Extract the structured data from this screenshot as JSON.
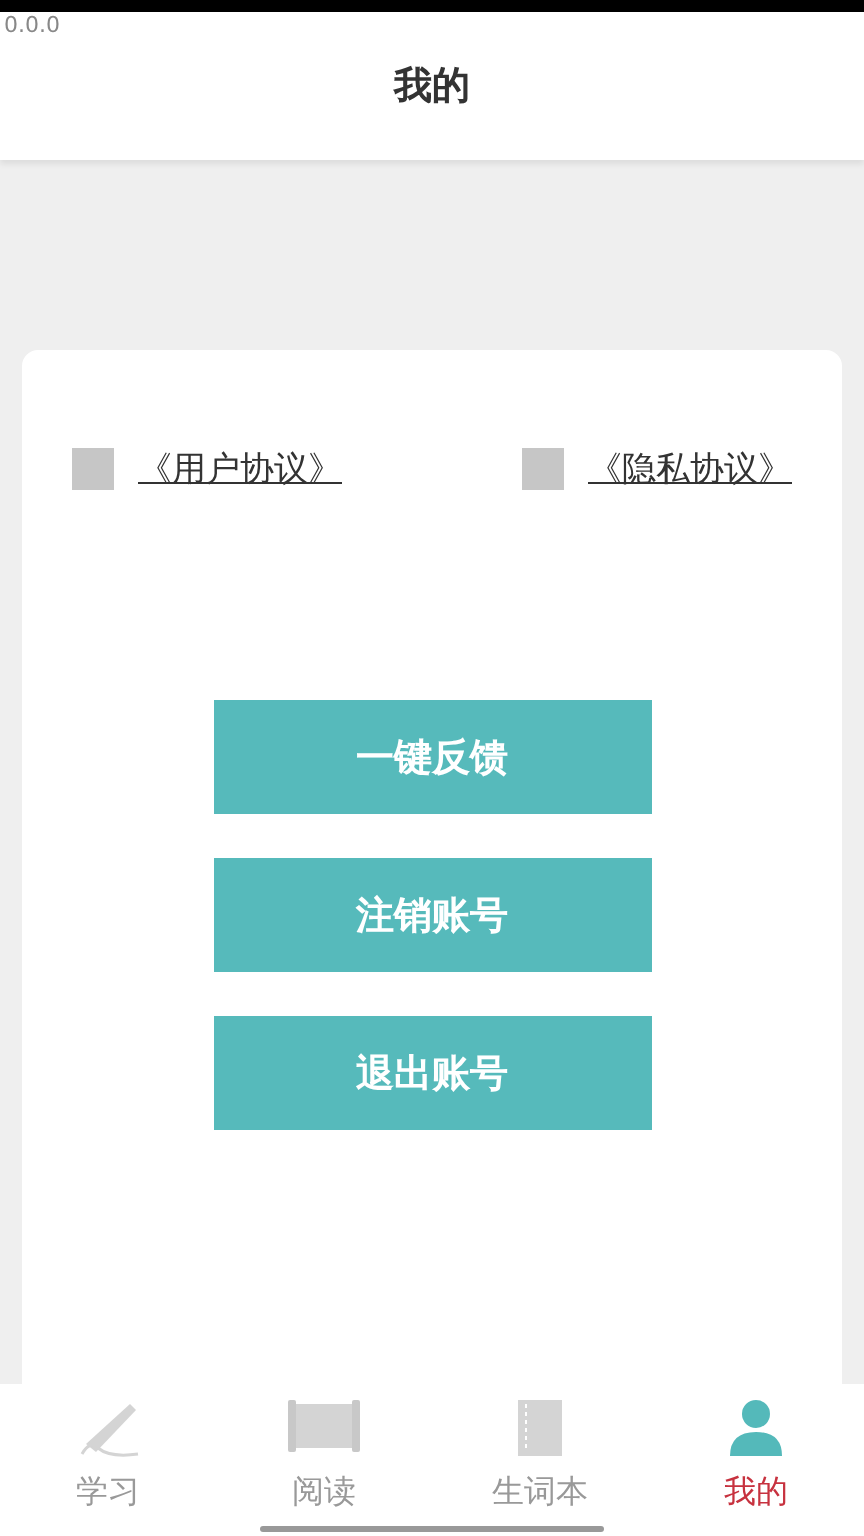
{
  "version": "0.0.0",
  "header": {
    "title": "我的"
  },
  "agreements": [
    {
      "label": "《用户协议》",
      "checked": false
    },
    {
      "label": "《隐私协议》",
      "checked": false
    }
  ],
  "buttons": [
    "一键反馈",
    "注销账号",
    "退出账号"
  ],
  "tabs": [
    {
      "label": "学习",
      "kind": "pen",
      "selected": false
    },
    {
      "label": "阅读",
      "kind": "scroll",
      "selected": false
    },
    {
      "label": "生词本",
      "kind": "notebook",
      "selected": false
    },
    {
      "label": "我的",
      "kind": "person",
      "selected": true
    }
  ]
}
